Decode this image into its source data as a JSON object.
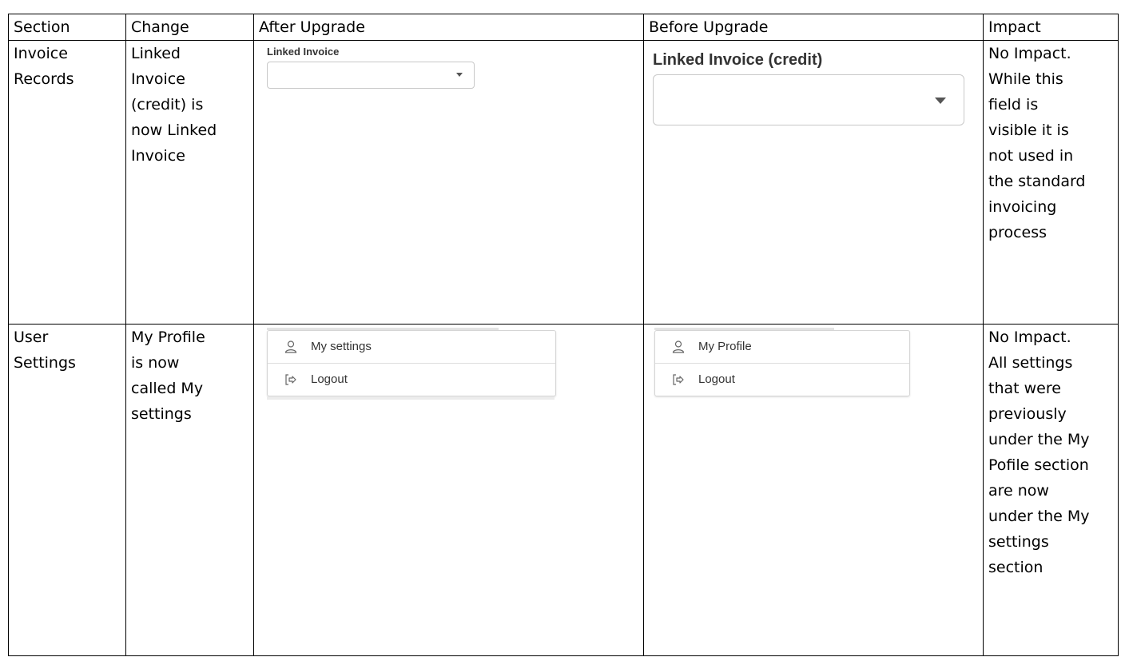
{
  "headers": {
    "section": "Section",
    "change": "Change",
    "after": "After Upgrade",
    "before": "Before Upgrade",
    "impact": "Impact"
  },
  "rows": [
    {
      "section": "Invoice Records",
      "change": "Linked Invoice (credit) is now Linked Invoice",
      "after": {
        "field_label": "Linked Invoice",
        "field_value": ""
      },
      "before": {
        "field_label": "Linked Invoice (credit)",
        "field_value": ""
      },
      "impact": "No Impact. While this field is visible it is not used in the standard invoicing process"
    },
    {
      "section": "User Settings",
      "change": "My Profile is now called My settings",
      "after": {
        "menu_items": [
          "My settings",
          "Logout"
        ]
      },
      "before": {
        "menu_items": [
          "My Profile",
          "Logout"
        ]
      },
      "impact": "No Impact. All settings that were previously under the My Pofile section are now under the My settings section"
    }
  ],
  "icons": {
    "settings_item": "user-icon",
    "logout_item": "logout-icon"
  }
}
